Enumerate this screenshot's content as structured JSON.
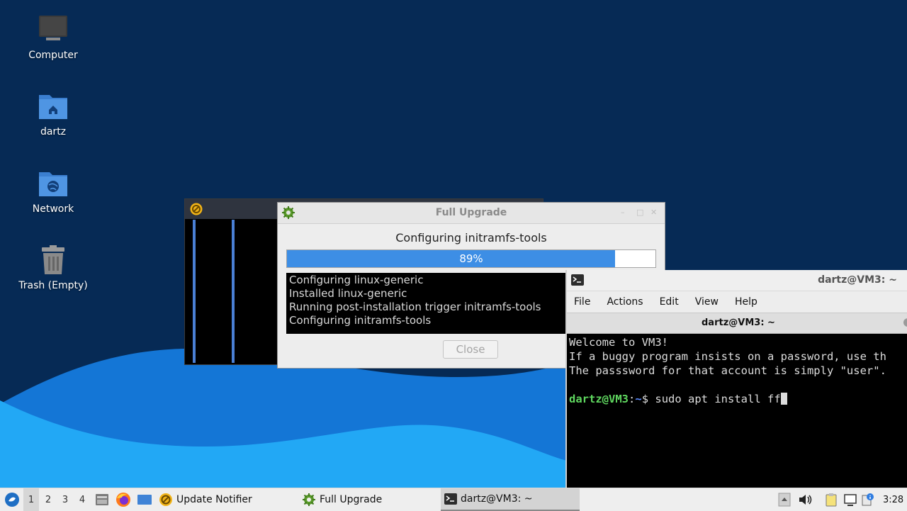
{
  "desktop": {
    "icons": [
      {
        "label": "Computer"
      },
      {
        "label": "dartz"
      },
      {
        "label": "Network"
      },
      {
        "label": "Trash (Empty)"
      }
    ]
  },
  "full_upgrade": {
    "title": "Full Upgrade",
    "status": "Configuring initramfs-tools",
    "progress_label": "89%",
    "progress_value": 0.89,
    "log": [
      "Configuring linux-generic",
      "Installed linux-generic",
      "Running post-installation trigger initramfs-tools",
      "Configuring initramfs-tools"
    ],
    "close_label": "Close"
  },
  "terminal": {
    "title": "dartz@VM3: ~",
    "menu": [
      "File",
      "Actions",
      "Edit",
      "View",
      "Help"
    ],
    "tab_title": "dartz@VM3: ~",
    "lines": [
      "Welcome to VM3!",
      "If a buggy program insists on a password, use th",
      "The passsword for that account is simply \"user\"."
    ],
    "prompt_user": "dartz@VM3",
    "prompt_sep": ":",
    "prompt_dir": "~",
    "prompt_symbol": "$ ",
    "command": "sudo apt install ff"
  },
  "taskbar": {
    "workspaces": [
      "1",
      "2",
      "3",
      "4"
    ],
    "tasks": [
      {
        "label": "Update Notifier",
        "icon": "update-notifier-icon"
      },
      {
        "label": "Full Upgrade",
        "icon": "gear-icon"
      },
      {
        "label": "dartz@VM3: ~",
        "icon": "terminal-icon"
      }
    ],
    "clock": "3:28"
  },
  "colors": {
    "desktop_bg": "#062a55",
    "wave": "#1a9cf0",
    "progress": "#3d8ee5",
    "prompt_user": "#5fd75f",
    "prompt_dir": "#5c8cff"
  }
}
